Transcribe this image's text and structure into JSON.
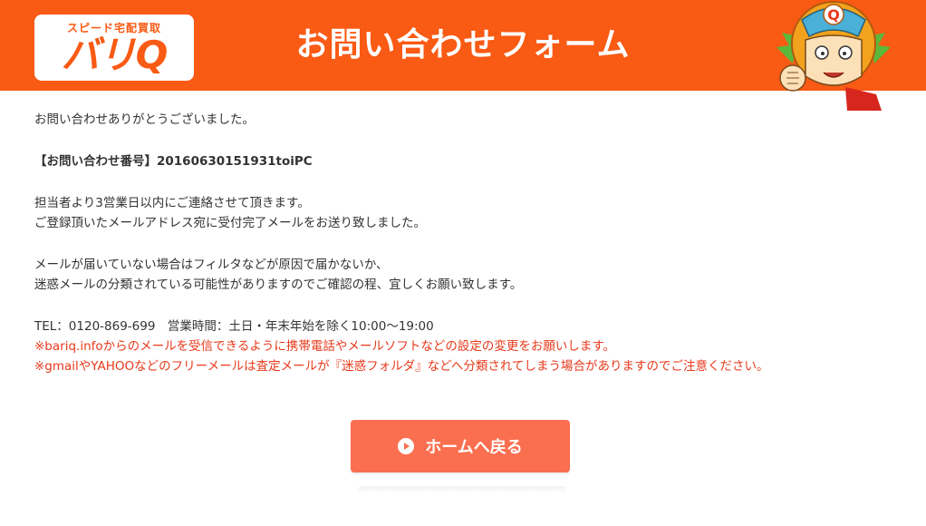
{
  "header": {
    "logo_tagline": "スピード宅配買取",
    "logo_name": "バリQ",
    "title": "お問い合わせフォーム",
    "mascot_badge": "Q",
    "color": "#f95a14"
  },
  "content": {
    "thanks": "お問い合わせありがとうございました。",
    "inquiry_number": "【お問い合わせ番号】20160630151931toiPC",
    "contact_lines": [
      "担当者より3営業日以内にご連絡させて頂きます。",
      "ご登録頂いたメールアドレス宛に受付完了メールをお送り致しました。"
    ],
    "no_mail_lines": [
      "メールが届いていない場合はフィルタなどが原因で届かないか、",
      "迷惑メールの分類されている可能性がありますのでご確認の程、宜しくお願い致します。"
    ],
    "tel": "TEL：0120-869-699　営業時間：土日・年末年始を除く10:00〜19:00",
    "notes": [
      "※bariq.infoからのメールを受信できるように携帯電話やメールソフトなどの設定の変更をお願いします。",
      "※gmailやYAHOOなどのフリーメールは査定メールが『迷惑フォルダ』などへ分類されてしまう場合がありますのでご注意ください。"
    ],
    "note_color": "#e8391b"
  },
  "home_button": {
    "label": "ホームへ戻る",
    "icon": "play-circle-icon",
    "color": "#fa6f50"
  }
}
